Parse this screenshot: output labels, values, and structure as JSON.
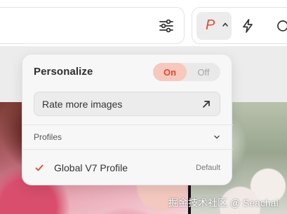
{
  "toolbar": {
    "filter_icon": "sliders-icon",
    "persona_letter": "P",
    "persona_caret_icon": "chevron-up-icon",
    "bolt_icon": "lightning-icon",
    "accent_color": "#e2492c"
  },
  "popover": {
    "title": "Personalize",
    "toggle": {
      "on_label": "On",
      "off_label": "Off",
      "state": "on"
    },
    "rate_button": {
      "label": "Rate more images",
      "icon": "arrow-up-right-icon"
    },
    "profiles": {
      "label": "Profiles",
      "icon": "chevron-down-icon",
      "items": [
        {
          "name": "Global V7 Profile",
          "tag": "Default",
          "selected": true,
          "icon": "checkmark-icon"
        }
      ]
    }
  },
  "watermark": {
    "text": "掘金技术社区 @ Seachal"
  }
}
